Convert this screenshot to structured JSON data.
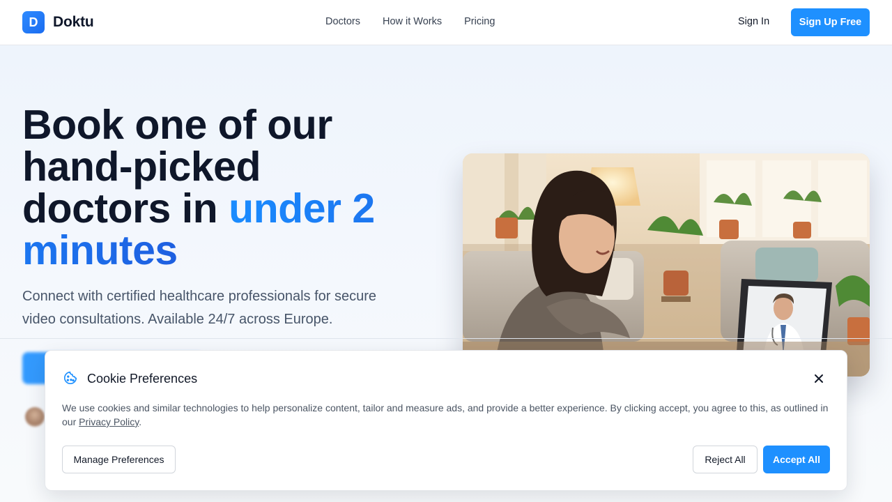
{
  "brand": {
    "logo_letter": "D",
    "name": "Doktu"
  },
  "nav": {
    "items": [
      "Doctors",
      "How it Works",
      "Pricing"
    ]
  },
  "auth": {
    "sign_in": "Sign In",
    "sign_up": "Sign Up Free"
  },
  "hero": {
    "title_part1": "Book one of our hand-picked doctors in ",
    "title_accent": "under 2 minutes",
    "subtitle": "Connect with certified healthcare professionals for secure video consultations. Available 24/7 across Europe."
  },
  "cookie": {
    "title": "Cookie Preferences",
    "body": "We use cookies and similar technologies to help personalize content, tailor and measure ads, and provide a better experience. By clicking accept, you agree to this, as outlined in our ",
    "link": "Privacy Policy",
    "body_end": ".",
    "manage": "Manage Preferences",
    "reject": "Reject All",
    "accept": "Accept All",
    "icon": "cookie-icon",
    "close_icon": "close-icon"
  },
  "colors": {
    "accent": "#1e90ff",
    "title": "#0f172a"
  }
}
